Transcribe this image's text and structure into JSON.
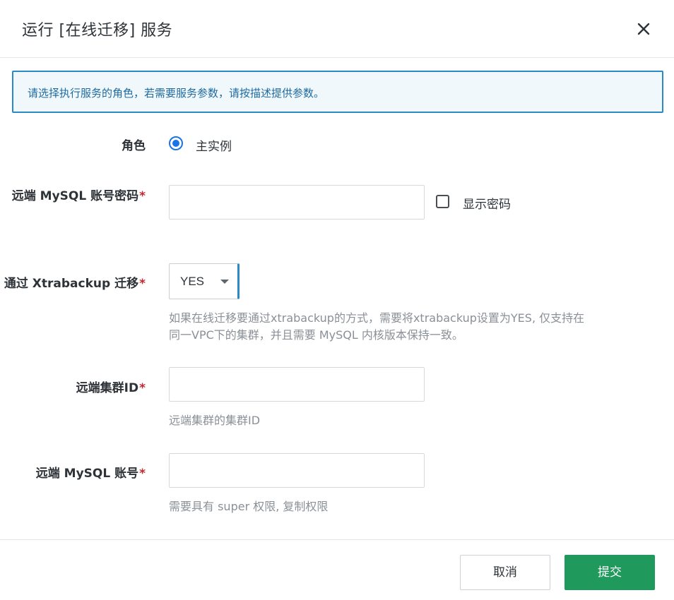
{
  "dialog": {
    "title": "运行 [在线迁移] 服务",
    "close_icon": "close-icon"
  },
  "notice": {
    "text": "请选择执行服务的角色，若需要服务参数，请按描述提供参数。"
  },
  "form": {
    "role": {
      "label": "角色",
      "option": "主实例",
      "selected": true
    },
    "remote_password": {
      "label": "远端 MySQL 账号密码",
      "required_mark": "*",
      "value": "",
      "show_password_label": "显示密码",
      "show_password_checked": false
    },
    "xtrabackup": {
      "label": "通过 Xtrabackup 迁移",
      "required_mark": "*",
      "value": "YES",
      "help_line1": "如果在线迁移要通过xtrabackup的方式，需要将xtrabackup设置为YES, 仅支持在",
      "help_line2": "同一VPC下的集群，并且需要 MySQL 内核版本保持一致。"
    },
    "remote_cluster_id": {
      "label": "远端集群ID",
      "required_mark": "*",
      "value": "",
      "help": "远端集群的集群ID"
    },
    "remote_account": {
      "label": "远端 MySQL 账号",
      "required_mark": "*",
      "value": "",
      "help": "需要具有 super 权限, 复制权限"
    }
  },
  "footer": {
    "cancel_label": "取消",
    "submit_label": "提交"
  },
  "colors": {
    "accent": "#1a73e8",
    "notice_border": "#2b8ac6",
    "submit": "#1f9a5c",
    "required": "#c1272d"
  }
}
